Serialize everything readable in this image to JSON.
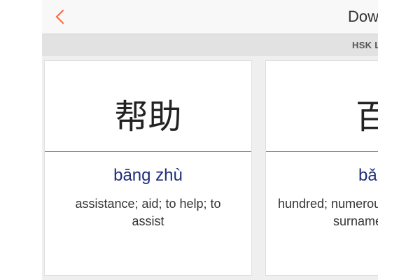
{
  "header": {
    "title": "Dow",
    "subtitle": "HSK L"
  },
  "cards": [
    {
      "hanzi": "帮助",
      "pinyin": "bāng zhù",
      "meaning_line1": "assistance; aid; to help; to",
      "meaning_line2": "assist"
    },
    {
      "hanzi": "百",
      "pinyin": "bǎ",
      "meaning_line1": "hundred; numerou",
      "meaning_line2": "surname"
    }
  ],
  "colors": {
    "accent": "#ff6b3d",
    "pinyin": "#1e2f7a"
  }
}
